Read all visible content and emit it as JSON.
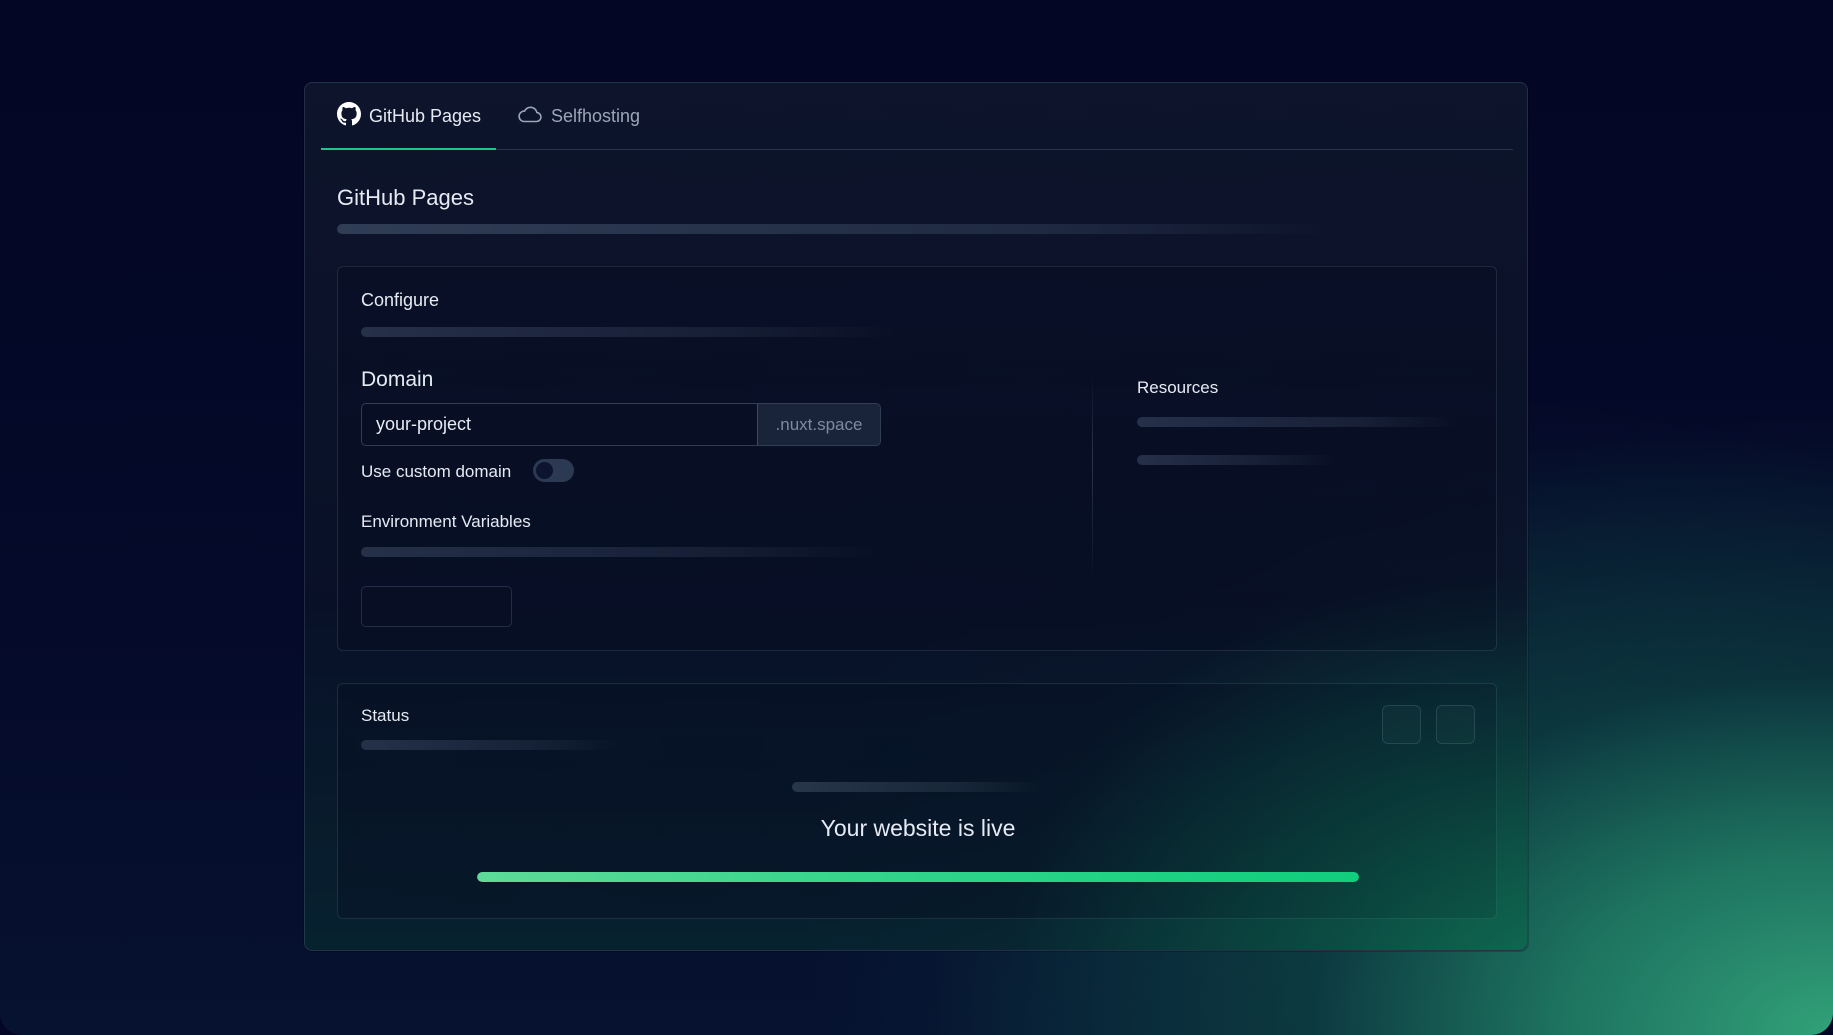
{
  "tabs": [
    {
      "label": "GitHub Pages",
      "icon": "github-icon",
      "active": true
    },
    {
      "label": "Selfhosting",
      "icon": "cloud-icon",
      "active": false
    }
  ],
  "page": {
    "title": "GitHub Pages"
  },
  "configure": {
    "title": "Configure",
    "domain_label": "Domain",
    "domain_value": "your-project",
    "domain_suffix": ".nuxt.space",
    "custom_domain_label": "Use custom domain",
    "custom_domain_enabled": false,
    "env_label": "Environment Variables",
    "resources_label": "Resources"
  },
  "status": {
    "title": "Status",
    "live_text": "Your website is live",
    "progress": 1.0
  },
  "colors": {
    "accent": "#19c98a",
    "progress_start": "#5edb98",
    "progress_end": "#10d27f",
    "background": "#030624"
  }
}
